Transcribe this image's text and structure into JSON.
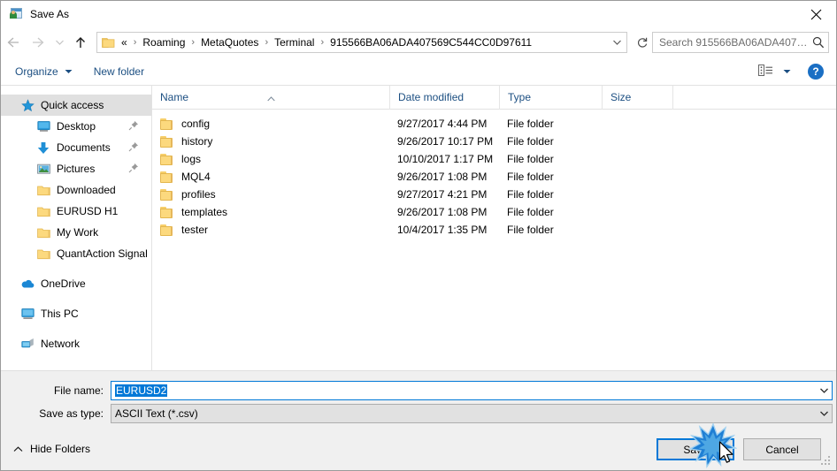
{
  "window": {
    "title": "Save As",
    "icon": "save-as-icon",
    "close_label": "✕"
  },
  "nav": {
    "back": "back-arrow",
    "forward": "forward-arrow",
    "recent": "recent-locations-chevron",
    "up": "up-arrow"
  },
  "address": {
    "prefix": "«",
    "crumbs": [
      "Roaming",
      "MetaQuotes",
      "Terminal",
      "915566BA06ADA407569C544CC0D97611"
    ],
    "separator": "›",
    "dropdown": "chevron-down-icon",
    "refresh": "refresh-icon"
  },
  "search": {
    "placeholder": "Search 915566BA06ADA40756...",
    "icon": "search-icon"
  },
  "toolbar": {
    "organize_label": "Organize",
    "organize_caret": "▼",
    "new_folder_label": "New folder",
    "view_icon": "view-layout-icon",
    "view_caret": "▼",
    "help_label": "?"
  },
  "sidebar": {
    "items": [
      {
        "label": "Quick access",
        "icon": "star-icon",
        "selected": true,
        "indent": false,
        "pinned": false
      },
      {
        "label": "Desktop",
        "icon": "monitor-icon",
        "selected": false,
        "indent": true,
        "pinned": true
      },
      {
        "label": "Documents",
        "icon": "download-arrow-icon",
        "selected": false,
        "indent": true,
        "pinned": true
      },
      {
        "label": "Pictures",
        "icon": "picture-icon",
        "selected": false,
        "indent": true,
        "pinned": true
      },
      {
        "label": "Downloaded",
        "icon": "folder-icon",
        "selected": false,
        "indent": true,
        "pinned": false
      },
      {
        "label": "EURUSD H1",
        "icon": "folder-icon",
        "selected": false,
        "indent": true,
        "pinned": false
      },
      {
        "label": "My Work",
        "icon": "folder-icon",
        "selected": false,
        "indent": true,
        "pinned": false
      },
      {
        "label": "QuantAction Signal",
        "icon": "folder-icon",
        "selected": false,
        "indent": true,
        "pinned": false
      },
      {
        "label": "OneDrive",
        "icon": "onedrive-cloud-icon",
        "selected": false,
        "indent": false,
        "pinned": false,
        "gap_before": true
      },
      {
        "label": "This PC",
        "icon": "computer-icon",
        "selected": false,
        "indent": false,
        "pinned": false,
        "gap_before": true
      },
      {
        "label": "Network",
        "icon": "network-icon",
        "selected": false,
        "indent": false,
        "pinned": false,
        "gap_before": true
      }
    ]
  },
  "filelist": {
    "columns": [
      "Name",
      "Date modified",
      "Type",
      "Size"
    ],
    "sort_indicator": "ascending-caret",
    "rows": [
      {
        "name": "config",
        "date": "9/27/2017 4:44 PM",
        "type": "File folder",
        "size": ""
      },
      {
        "name": "history",
        "date": "9/26/2017 10:17 PM",
        "type": "File folder",
        "size": ""
      },
      {
        "name": "logs",
        "date": "10/10/2017 1:17 PM",
        "type": "File folder",
        "size": ""
      },
      {
        "name": "MQL4",
        "date": "9/26/2017 1:08 PM",
        "type": "File folder",
        "size": ""
      },
      {
        "name": "profiles",
        "date": "9/27/2017 4:21 PM",
        "type": "File folder",
        "size": ""
      },
      {
        "name": "templates",
        "date": "9/26/2017 1:08 PM",
        "type": "File folder",
        "size": ""
      },
      {
        "name": "tester",
        "date": "10/4/2017 1:35 PM",
        "type": "File folder",
        "size": ""
      }
    ]
  },
  "form": {
    "filename_label": "File name:",
    "filename_value": "EURUSD2",
    "savetype_label": "Save as type:",
    "savetype_value": "ASCII Text (*.csv)",
    "dropdown_icon": "chevron-down-icon"
  },
  "footer": {
    "hide_folders_label": "Hide Folders",
    "hide_folders_chevron": "∧",
    "save_label": "Save",
    "cancel_label": "Cancel",
    "resize_grip": "resize-grip"
  },
  "colors": {
    "accent": "#0078d7",
    "header_text": "#1c4f82",
    "panel": "#f0f0f0",
    "selection": "#e0e0e0",
    "folder": "#fcd97e"
  }
}
